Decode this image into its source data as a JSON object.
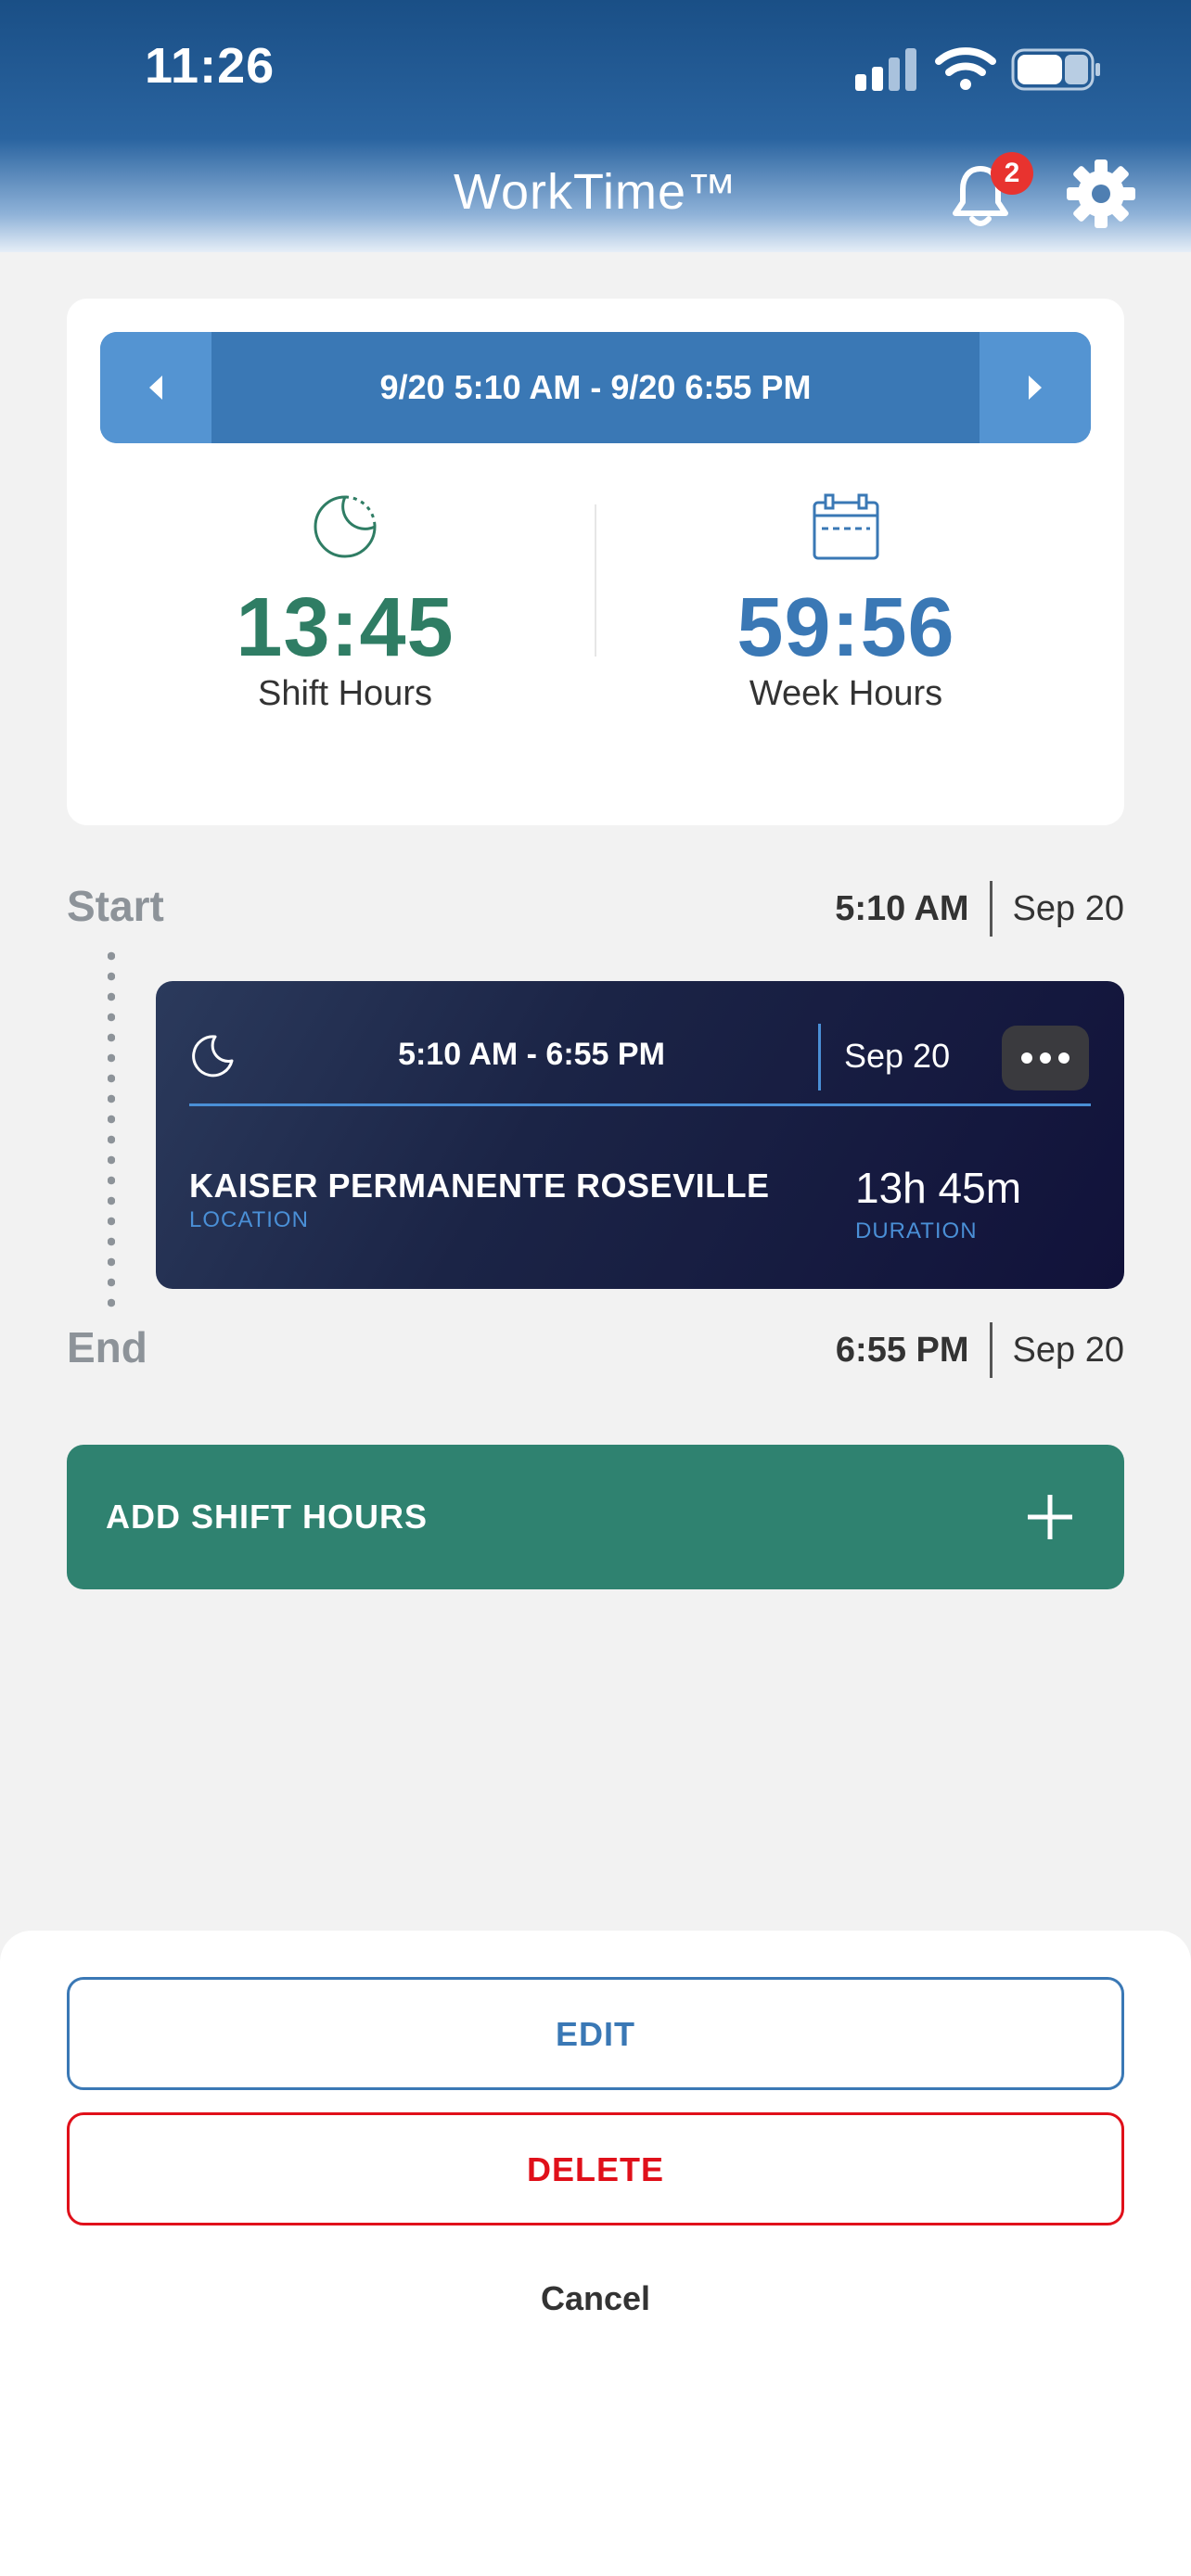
{
  "status_bar": {
    "time": "11:26"
  },
  "header": {
    "title": "WorkTime™",
    "notification_count": "2"
  },
  "summary": {
    "range_label": "9/20 5:10 AM - 9/20 6:55 PM",
    "shift_hours": {
      "value": "13:45",
      "label": "Shift Hours"
    },
    "week_hours": {
      "value": "59:56",
      "label": "Week Hours"
    }
  },
  "timeline": {
    "start": {
      "label": "Start",
      "time": "5:10 AM",
      "date": "Sep 20"
    },
    "end": {
      "label": "End",
      "time": "6:55 PM",
      "date": "Sep 20"
    }
  },
  "shift_card": {
    "time_range": "5:10 AM - 6:55 PM",
    "date": "Sep 20",
    "location": "KAISER PERMANENTE ROSEVILLE",
    "location_label": "LOCATION",
    "duration": "13h 45m",
    "duration_label": "DURATION"
  },
  "add_shift": {
    "label": "ADD SHIFT HOURS"
  },
  "action_sheet": {
    "edit_label": "EDIT",
    "delete_label": "DELETE",
    "cancel_label": "Cancel"
  },
  "colors": {
    "accent_blue": "#3a78b5",
    "accent_green": "#2f7d64",
    "danger": "#e0101a",
    "card_dark": "#1b2446"
  }
}
